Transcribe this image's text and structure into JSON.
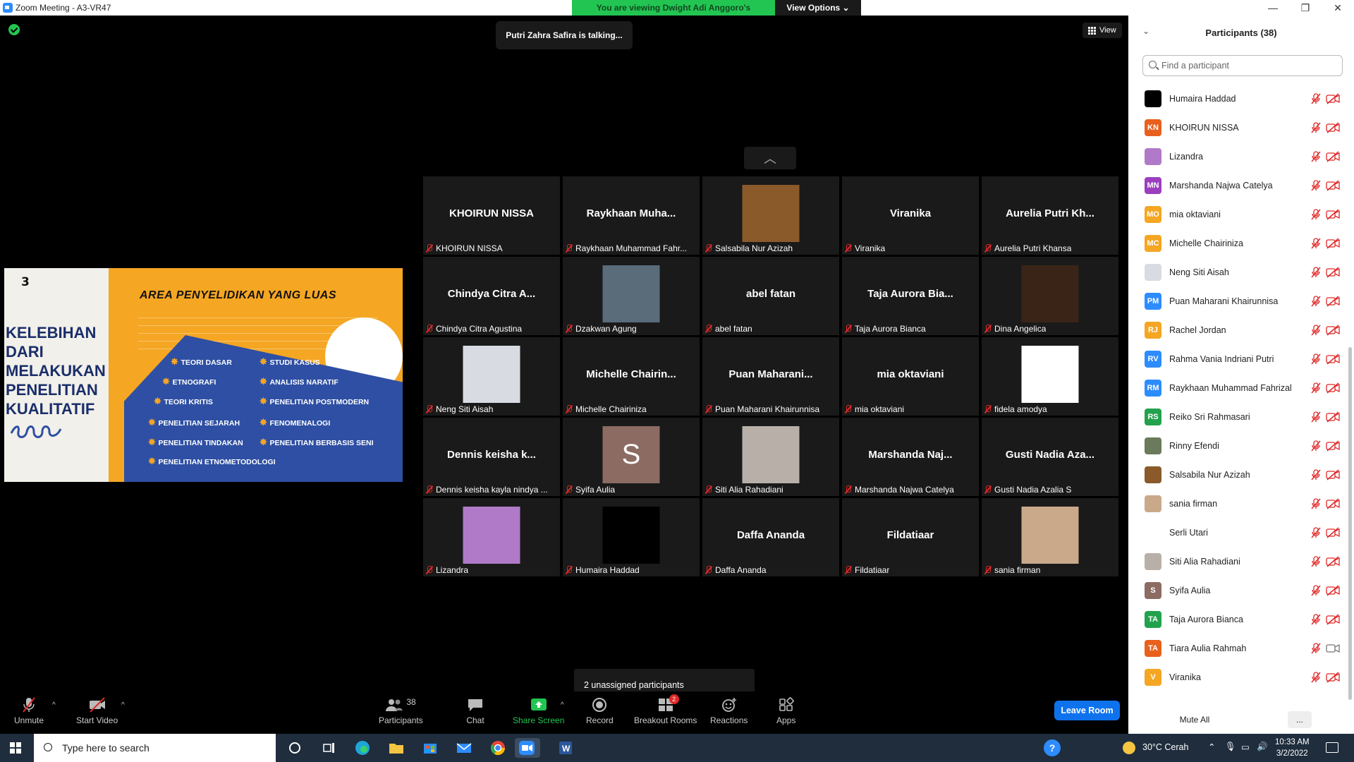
{
  "window": {
    "title": "Zoom Meeting - A3-VR47",
    "controls": [
      "—",
      "❐",
      "✕"
    ]
  },
  "banner": {
    "viewing_text": "You are viewing Dwight Adi Anggoro's screen",
    "view_options": "View Options ⌄"
  },
  "meeting": {
    "talking": "Putri Zahra Safira is talking...",
    "view_label": "View"
  },
  "slide": {
    "number": "3",
    "heading": "AREA PENYELIDIKAN YANG LUAS",
    "side_text": [
      "KELEBIHAN",
      "DARI",
      "MELAKUKAN",
      "PENELITIAN",
      "KUALITATIF"
    ],
    "topics_left": [
      "TEORI DASAR",
      "ETNOGRAFI",
      "TEORI KRITIS",
      "PENELITIAN SEJARAH",
      "PENELITIAN TINDAKAN",
      "PENELITIAN ETNOMETODOLOGI"
    ],
    "topics_right": [
      "STUDI KASUS",
      "ANALISIS NARATIF",
      "PENELITIAN POSTMODERN",
      "FENOMENALOGI",
      "PENELITIAN BERBASIS SENI"
    ]
  },
  "gallery": {
    "page_up": "︿",
    "tiles": [
      {
        "big": "KHOIRUN NISSA",
        "caption": "KHOIRUN NISSA",
        "photo": ""
      },
      {
        "big": "Raykhaan  Muha...",
        "caption": "Raykhaan Muhammad Fahr...",
        "photo": ""
      },
      {
        "big": "",
        "caption": "Salsabila Nur Azizah",
        "photo": "#8a5a2b"
      },
      {
        "big": "Viranika",
        "caption": "Viranika",
        "photo": ""
      },
      {
        "big": "Aurelia Putri Kh...",
        "caption": "Aurelia Putri Khansa",
        "photo": ""
      },
      {
        "big": "Chindya Citra A...",
        "caption": "Chindya Citra Agustina",
        "photo": ""
      },
      {
        "big": "",
        "caption": "Dzakwan Agung",
        "photo": "#5a6b7a"
      },
      {
        "big": "abel fatan",
        "caption": "abel fatan",
        "photo": ""
      },
      {
        "big": "Taja Aurora Bia...",
        "caption": "Taja Aurora Bianca",
        "photo": ""
      },
      {
        "big": "",
        "caption": "Dina Angelica",
        "photo": "#3a2418"
      },
      {
        "big": "",
        "caption": "Neng Siti Aisah",
        "photo": "#d8dce2"
      },
      {
        "big": "Michelle  Chairin...",
        "caption": "Michelle Chairiniza",
        "photo": ""
      },
      {
        "big": "Puan  Maharani...",
        "caption": "Puan Maharani Khairunnisa",
        "photo": ""
      },
      {
        "big": "mia oktaviani",
        "caption": "mia oktaviani",
        "photo": ""
      },
      {
        "big": "",
        "caption": "fidela amodya",
        "photo": "#ffffff"
      },
      {
        "big": "Dennis  keisha  k...",
        "caption": "Dennis keisha kayla nindya ...",
        "photo": ""
      },
      {
        "big": "",
        "caption": "Syifa Aulia",
        "photo": "#8c6b63",
        "letter": "S"
      },
      {
        "big": "",
        "caption": "Siti Alia Rahadiani",
        "photo": "#b8b0a8"
      },
      {
        "big": "Marshanda  Naj...",
        "caption": "Marshanda Najwa Catelya",
        "photo": ""
      },
      {
        "big": "Gusti Nadia Aza...",
        "caption": "Gusti Nadia Azalia S",
        "photo": ""
      },
      {
        "big": "",
        "caption": "Lizandra",
        "photo": "#b07ac8"
      },
      {
        "big": "",
        "caption": "Humaira Haddad",
        "photo": "#000000"
      },
      {
        "big": "Daffa Ananda",
        "caption": "Daffa Ananda",
        "photo": ""
      },
      {
        "big": "Fildatiaar",
        "caption": "Fildatiaar",
        "photo": ""
      },
      {
        "big": "",
        "caption": "sania firman",
        "photo": "#c9a98a"
      }
    ],
    "unassigned": "2 unassigned participants"
  },
  "toolbar": {
    "unmute": "Unmute",
    "start_video": "Start Video",
    "participants": "Participants",
    "participants_count": "38",
    "chat": "Chat",
    "share": "Share Screen",
    "record": "Record",
    "breakout": "Breakout Rooms",
    "breakout_badge": "2",
    "reactions": "Reactions",
    "apps": "Apps",
    "leave": "Leave Room",
    "caret": "^"
  },
  "panel": {
    "title": "Participants (38)",
    "collapse": "⌄",
    "search_placeholder": "Find a participant",
    "mute_all": "Mute All",
    "more": "...",
    "participants": [
      {
        "name": "Humaira Haddad",
        "initials": "",
        "color": "#000000",
        "video": "off"
      },
      {
        "name": "KHOIRUN NISSA",
        "initials": "KN",
        "color": "#e8601c",
        "video": "off"
      },
      {
        "name": "Lizandra",
        "initials": "",
        "color": "#b07ac8",
        "video": "off"
      },
      {
        "name": "Marshanda Najwa Catelya",
        "initials": "MN",
        "color": "#9b3fbf",
        "video": "off"
      },
      {
        "name": "mia oktaviani",
        "initials": "MO",
        "color": "#f5a623",
        "video": "off"
      },
      {
        "name": "Michelle Chairiniza",
        "initials": "MC",
        "color": "#f5a623",
        "video": "off"
      },
      {
        "name": "Neng Siti Aisah",
        "initials": "",
        "color": "#d8dce2",
        "video": "off"
      },
      {
        "name": "Puan Maharani Khairunnisa",
        "initials": "PM",
        "color": "#2d8cff",
        "video": "off"
      },
      {
        "name": "Rachel Jordan",
        "initials": "RJ",
        "color": "#f5a623",
        "video": "off"
      },
      {
        "name": "Rahma Vania Indriani Putri",
        "initials": "RV",
        "color": "#2d8cff",
        "video": "off"
      },
      {
        "name": "Raykhaan Muhammad Fahrizal",
        "initials": "RM",
        "color": "#2d8cff",
        "video": "off"
      },
      {
        "name": "Reiko Sri Rahmasari",
        "initials": "RS",
        "color": "#23a24d",
        "video": "off"
      },
      {
        "name": "Rinny Efendi",
        "initials": "",
        "color": "#6b7a5a",
        "video": "off"
      },
      {
        "name": "Salsabila Nur Azizah",
        "initials": "",
        "color": "#8a5a2b",
        "video": "off"
      },
      {
        "name": "sania firman",
        "initials": "",
        "color": "#c9a98a",
        "video": "off"
      },
      {
        "name": "Serli Utari",
        "initials": "",
        "color": "#ffffff",
        "video": "off"
      },
      {
        "name": "Siti Alia Rahadiani",
        "initials": "",
        "color": "#b8b0a8",
        "video": "off"
      },
      {
        "name": "Syifa Aulia",
        "initials": "S",
        "color": "#8c6b63",
        "video": "off"
      },
      {
        "name": "Taja Aurora Bianca",
        "initials": "TA",
        "color": "#23a24d",
        "video": "off"
      },
      {
        "name": "Tiara Aulia Rahmah",
        "initials": "TA",
        "color": "#e8601c",
        "video": "on"
      },
      {
        "name": "Viranika",
        "initials": "V",
        "color": "#f5a623",
        "video": "off"
      }
    ]
  },
  "taskbar": {
    "search_placeholder": "Type here to search",
    "weather": "30°C  Cerah",
    "time": "10:33 AM",
    "date": "3/2/2022"
  }
}
